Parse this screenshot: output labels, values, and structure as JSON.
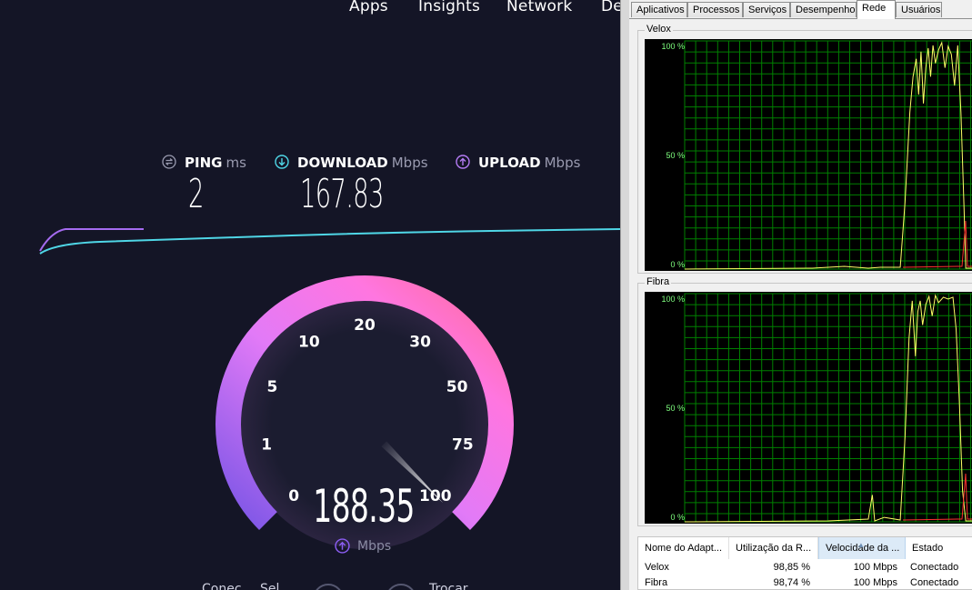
{
  "speedtest": {
    "nav": [
      "Apps",
      "Insights",
      "Network",
      "De"
    ],
    "stats": {
      "ping": {
        "label": "PING",
        "unit": "ms",
        "value": "2"
      },
      "download": {
        "label": "DOWNLOAD",
        "unit": "Mbps",
        "value": "167.83"
      },
      "upload": {
        "label": "UPLOAD",
        "unit": "Mbps",
        "value": ""
      }
    },
    "gauge": {
      "ticks": [
        "0",
        "1",
        "5",
        "10",
        "20",
        "30",
        "50",
        "75",
        "100"
      ],
      "current_value": "188.35",
      "unit": "Mbps",
      "needle_fraction": 1.0
    },
    "bottom_buttons": [
      "Conec",
      "Sel",
      "Trocar"
    ],
    "colors": {
      "background": "#141526",
      "download_line": "#4fd6e6",
      "upload_line": "#a56bf0",
      "gauge_start": "#8a5cf0",
      "gauge_mid": "#f07cf6",
      "gauge_end": "#ff6fa8"
    }
  },
  "task_manager": {
    "tabs": [
      "Aplicativos",
      "Processos",
      "Serviços",
      "Desempenho",
      "Rede",
      "Usuários"
    ],
    "active_tab": "Rede",
    "graphs": [
      {
        "name": "Velox",
        "y_labels": [
          "100 %",
          "50 %",
          "0 %"
        ]
      },
      {
        "name": "Fibra",
        "y_labels": [
          "100 %",
          "50 %",
          "0 %"
        ]
      }
    ],
    "table": {
      "columns": [
        "Nome do Adapt...",
        "Utilização da R...",
        "Velocidade da ...",
        "Estado"
      ],
      "sorted_column": 2,
      "rows": [
        {
          "name": "Velox",
          "utilization": "98,85 %",
          "speed": "100 Mbps",
          "state": "Conectado"
        },
        {
          "name": "Fibra",
          "utilization": "98,74 %",
          "speed": "100 Mbps",
          "state": "Conectado"
        }
      ]
    },
    "colors": {
      "grid": "#008000",
      "trace": "#ffff66",
      "trace_send": "#ff3030"
    }
  }
}
